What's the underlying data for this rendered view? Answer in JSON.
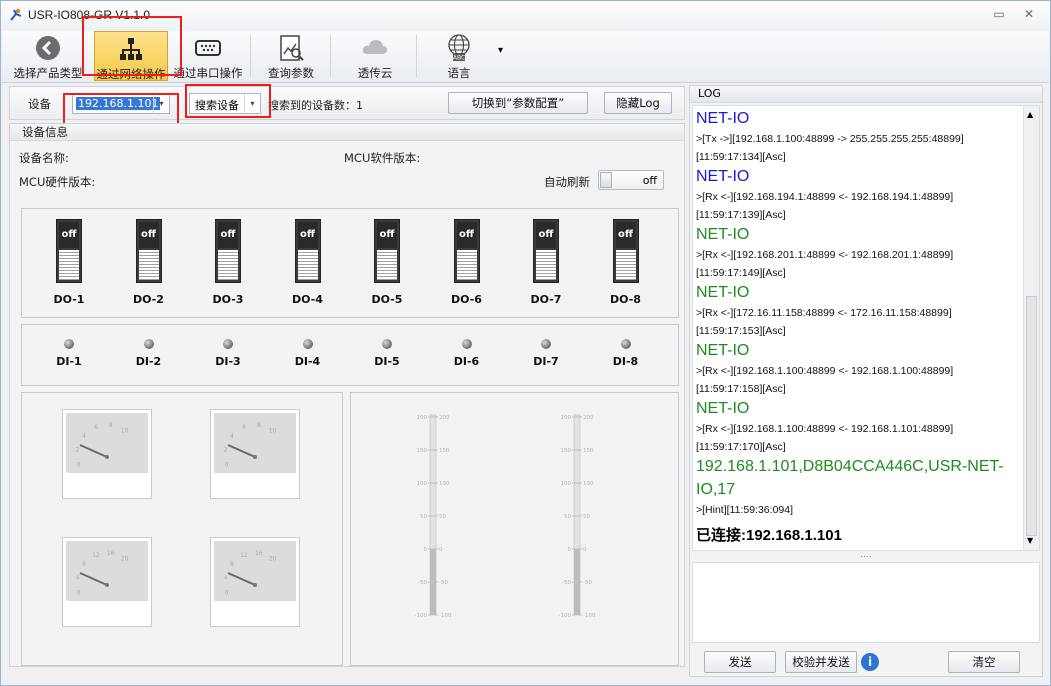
{
  "window": {
    "title": "USR-IO808-GR V1.1.0",
    "minimize_glyph": "▭",
    "close_glyph": "✕"
  },
  "toolbar": {
    "items": [
      {
        "label": "选择产品类型",
        "icon": "back-arrow-icon"
      },
      {
        "label": "通过网络操作",
        "icon": "network-icon"
      },
      {
        "label": "通过串口操作",
        "icon": "serial-port-icon"
      },
      {
        "label": "查询参数",
        "icon": "query-icon"
      },
      {
        "label": "透传云",
        "icon": "cloud-icon"
      },
      {
        "label": "语言",
        "icon": "globe-abc-icon"
      }
    ],
    "more_glyph": "▾"
  },
  "device_bar": {
    "device_label": "设备",
    "device_value": "192.168.1.101",
    "search_label": "搜索设备",
    "found_label": "搜索到的设备数：1",
    "switch_label": "切换到“参数配置”",
    "hide_log_label": "隐藏Log",
    "arrow_glyph": "▾"
  },
  "device_info": {
    "group_title": "设备信息",
    "device_name_label": "设备名称:",
    "mcu_sw_label": "MCU软件版本:",
    "mcu_hw_label": "MCU硬件版本:",
    "auto_refresh_label": "自动刷新",
    "auto_refresh_state": "off"
  },
  "outputs": [
    {
      "label": "DO-1",
      "state": "off"
    },
    {
      "label": "DO-2",
      "state": "off"
    },
    {
      "label": "DO-3",
      "state": "off"
    },
    {
      "label": "DO-4",
      "state": "off"
    },
    {
      "label": "DO-5",
      "state": "off"
    },
    {
      "label": "DO-6",
      "state": "off"
    },
    {
      "label": "DO-7",
      "state": "off"
    },
    {
      "label": "DO-8",
      "state": "off"
    }
  ],
  "inputs": [
    "DI-1",
    "DI-2",
    "DI-3",
    "DI-4",
    "DI-5",
    "DI-6",
    "DI-7",
    "DI-8"
  ],
  "gauge_ticks": [
    "0",
    "2",
    "4",
    "6",
    "8",
    "10"
  ],
  "gauge_ticks_b": [
    "0",
    "4",
    "8",
    "12",
    "16",
    "20"
  ],
  "thermo_ticks": [
    "200",
    "150",
    "100",
    "50",
    "0",
    "-50",
    "-100"
  ],
  "log": {
    "header": "LOG",
    "entries": [
      {
        "text": "NET-IO",
        "color": "#1a1ad6",
        "kind": "big"
      },
      {
        "text": ">[Tx ->][192.168.1.100:48899 -> 255.255.255.255:48899]",
        "kind": "small"
      },
      {
        "text": "[11:59:17:134][Asc]",
        "kind": "small"
      },
      {
        "text": "NET-IO",
        "color": "#1a1ad6",
        "kind": "big"
      },
      {
        "text": ">[Rx <-][192.168.194.1:48899 <- 192.168.194.1:48899]",
        "kind": "small"
      },
      {
        "text": "[11:59:17:139][Asc]",
        "kind": "small"
      },
      {
        "text": "NET-IO",
        "color": "#1e8c1e",
        "kind": "big"
      },
      {
        "text": ">[Rx <-][192.168.201.1:48899 <- 192.168.201.1:48899]",
        "kind": "small"
      },
      {
        "text": "[11:59:17:149][Asc]",
        "kind": "small"
      },
      {
        "text": "NET-IO",
        "color": "#1e8c1e",
        "kind": "big"
      },
      {
        "text": ">[Rx <-][172.16.11.158:48899 <- 172.16.11.158:48899]",
        "kind": "small"
      },
      {
        "text": "[11:59:17:153][Asc]",
        "kind": "small"
      },
      {
        "text": "NET-IO",
        "color": "#1e8c1e",
        "kind": "big"
      },
      {
        "text": ">[Rx <-][192.168.1.100:48899 <- 192.168.1.100:48899]",
        "kind": "small"
      },
      {
        "text": "[11:59:17:158][Asc]",
        "kind": "small"
      },
      {
        "text": "NET-IO",
        "color": "#1e8c1e",
        "kind": "big"
      },
      {
        "text": ">[Rx <-][192.168.1.100:48899 <- 192.168.1.101:48899]",
        "kind": "small"
      },
      {
        "text": "[11:59:17:170][Asc]",
        "kind": "small"
      },
      {
        "text": "192.168.1.101,D8B04CCA446C,USR-NET-",
        "color": "#1e8c1e",
        "kind": "big"
      },
      {
        "text": "IO,17",
        "color": "#1e8c1e",
        "kind": "big"
      },
      {
        "text": ">[Hint][11:59:36:094]",
        "kind": "small"
      },
      {
        "text": "已连接:192.168.1.101",
        "kind": "bold"
      }
    ],
    "send_label": "发送",
    "check_send_label": "校验并发送",
    "clear_label": "清空",
    "splitter_glyph": "....",
    "info_glyph": "i"
  }
}
